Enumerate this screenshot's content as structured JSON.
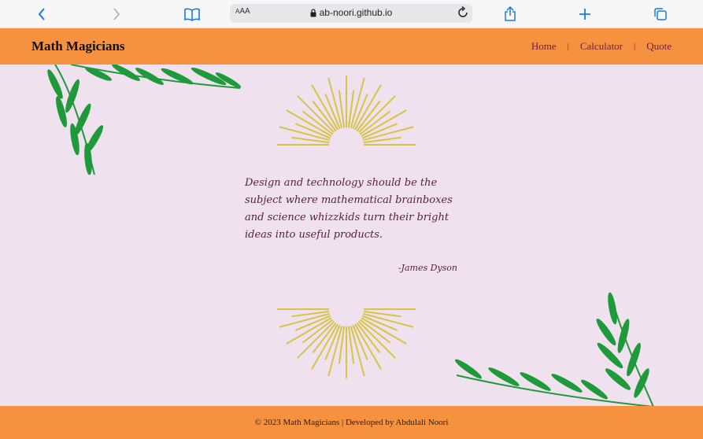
{
  "browser": {
    "text_size_label": "AA",
    "url": "ab-noori.github.io",
    "icons": [
      "back-icon",
      "forward-icon",
      "bookmarks-icon",
      "text-size-icon",
      "lock-icon",
      "reload-icon",
      "share-icon",
      "new-tab-icon",
      "tabs-icon"
    ]
  },
  "header": {
    "brand": "Math Magicians",
    "nav": [
      {
        "label": "Home"
      },
      {
        "label": "Calculator"
      },
      {
        "label": "Quote"
      }
    ],
    "separator": "|"
  },
  "main": {
    "quote": "Design and technology should be the subject where mathematical brainboxes and science whizzkids turn their bright ideas into useful products.",
    "author": "-James Dyson"
  },
  "footer": {
    "text": "© 2023 Math Magicians | Developed by Abdulali Noori"
  },
  "colors": {
    "accent": "#f5913f",
    "background": "#efe1ee",
    "text_dark": "#5c1d36",
    "leaf": "#1f9a3a",
    "sunburst": "#d6c447"
  }
}
